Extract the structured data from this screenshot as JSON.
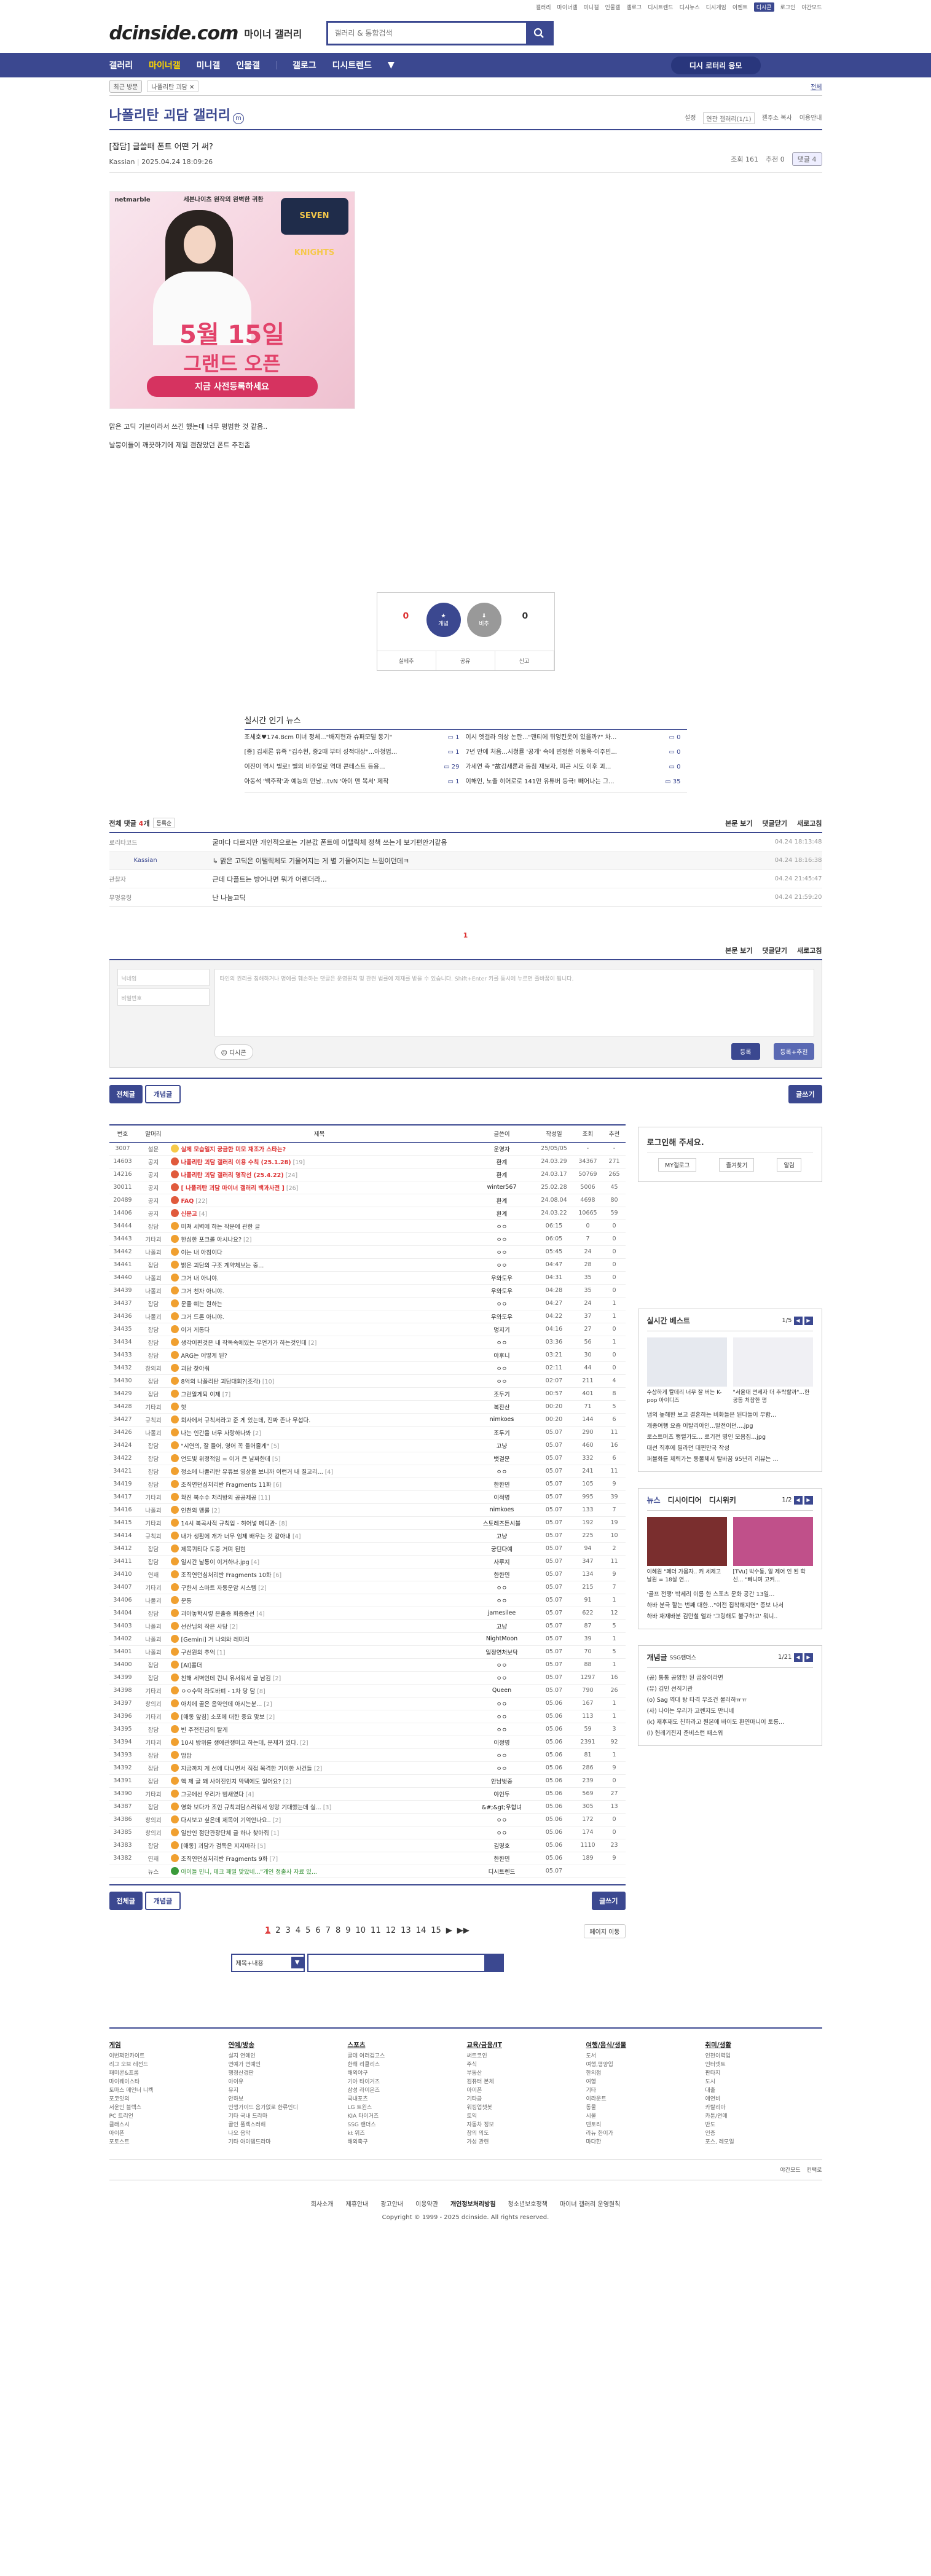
{
  "util": [
    "갤러리",
    "마이너갤",
    "미니갤",
    "인물갤",
    "갤로그",
    "디시트렌드",
    "디시뉴스",
    "디시게임",
    "이벤트",
    "디시콘",
    "로그인",
    "야간모드"
  ],
  "header": {
    "logo": "dcinside.com",
    "logo_sub": "마이너 갤러리",
    "search_placeholder": "갤러리 & 통합검색"
  },
  "gnb": {
    "items": [
      "갤러리",
      "마이너갤",
      "미니갤",
      "인물갤",
      "갤로그",
      "디시트렌드"
    ],
    "recent": "디시 로터리 응모"
  },
  "visit": {
    "btn": "최근 방문",
    "chip": "나폴리탄 괴담 ✕",
    "all": "전체"
  },
  "gallery": {
    "title": "나폴리탄 괴담 갤러리",
    "minor": "m",
    "tools": [
      "설정",
      "연관 갤러리(1/1)",
      "갤주소 복사",
      "이용안내"
    ]
  },
  "post": {
    "title": "[잡담] 글쓸때 폰트 어떤 거 써?",
    "author": "Kassian",
    "date": "2025.04.24 18:09:26",
    "views": "조회 161",
    "recommend": "추천 0",
    "comments": "댓글 4",
    "ad": {
      "brand": "netmarble",
      "tag": "세븐나이츠 원작의 완벽한 귀환",
      "game": "SEVEN KNIGHTS",
      "d1": "5월 15일",
      "d2": "그랜드 오픈",
      "d3": "지금 사전등록하세요"
    },
    "body": [
      "맑은 고딕 기본이라서 쓰긴 했는데 너무 평범한 것 같음..",
      "날붕이들이 깨끗하기에 제일 괜찮았던 폰트 추천좀"
    ]
  },
  "recommend": {
    "up_count": "0",
    "up_label": "개념",
    "down_count": "0",
    "down_label": "비추",
    "actions": [
      "실베추",
      "공유",
      "신고"
    ]
  },
  "news": {
    "title": "실시간 인기 뉴스",
    "items": [
      [
        "조세호♥174.8cm 미녀 정체...\"배지현과 슈퍼모델 동기\"",
        "1"
      ],
      [
        "이시 엣걸라 의상 논란...\"팬티에 뒤엉킨옷이 있을까?\" 차...",
        "0"
      ],
      [
        "[종] 김새론 유족 \"김수현, 중2때 부터 성적대상\"...아청법...",
        "1"
      ],
      [
        "7년 만에 처음...시청률 '공개' 속에 빈정한 이동욱·이주빈...",
        "0"
      ],
      [
        "이진이 역시 별로! 별의 비주얼로 역대 콘테스트 등용...",
        "29"
      ],
      [
        "가세연 측 \"故김새론과 동침 재보자, 피곤 시도 이후 괴...",
        "0"
      ],
      [
        "아동석 '백주작'과 예능의 만남...tvN '아이 맨 복서' 제작",
        "1"
      ],
      [
        "이해인, 노출 히어로로 141만 유튜버 등극! 빼어나는 그...",
        "35"
      ]
    ]
  },
  "comments": {
    "count_label": "전체 댓글",
    "count": "4",
    "sort": "등록순",
    "view": "본문 보기",
    "fold": "댓글닫기",
    "refresh": "새로고침",
    "items": [
      {
        "nick": "로리타코드",
        "text": "굴마다 다르지만 개인적으로는 기본값 폰트에 이탤릭체 정책 쓰는게 보기편안거같음",
        "date": "04.24 18:13:48",
        "reply": false
      },
      {
        "nick": "Kassian",
        "text": "맑은 고딕은 이탤릭체도 기울어지는 게 별 기울어지는 느낌이던데ㅋ",
        "date": "04.24 18:16:38",
        "reply": true
      },
      {
        "nick": "관찰자",
        "text": "근데 다플트는 방어나면 뭐가 어렌더라...",
        "date": "04.24 21:45:47",
        "reply": false
      },
      {
        "nick": "무명유령",
        "text": "난 나눔고딕",
        "date": "04.24 21:59:20",
        "reply": false
      }
    ],
    "page": "1",
    "write": {
      "nick": "닉네임",
      "pw": "비밀번호",
      "placeholder": "타인의 권리를 침해하거나 명예를 훼손하는 댓글은 운영원칙 및 관련 법률에 제재를 받을 수 있습니다. Shift+Enter 키를 동시에 누르면 줄바꿈이 됩니다.",
      "dccon": "디시콘",
      "submit": "등록",
      "submit2": "등록+추천"
    }
  },
  "list": {
    "buttons": {
      "all": "전체글",
      "concept": "개념글",
      "write": "글쓰기"
    },
    "headers": [
      "번호",
      "말머리",
      "제목",
      "글쓴이",
      "작성일",
      "조회",
      "추천"
    ],
    "rows": [
      [
        "3007",
        "설문",
        "실제 모습일지 궁금한 미모 재조가 스타는?",
        "",
        "운영자",
        "25/05/05",
        "-",
        "-",
        "n",
        "#f7c948"
      ],
      [
        "14603",
        "공지",
        "나폴리탄 괴담 갤러리 이용 수칙 (25.1.28)",
        "[19]",
        "환계",
        "24.03.29",
        "34367",
        "271",
        "n",
        "#e05a3c"
      ],
      [
        "14216",
        "공지",
        "나폴리탄 괴담 갤러리 명작선 (25.4.22)",
        "[24]",
        "환계",
        "24.03.17",
        "50769",
        "265",
        "n",
        "#e05a3c"
      ],
      [
        "30011",
        "공지",
        "[ 나폴리탄 괴담 마이너 갤러리 백과사전 ]",
        "[26]",
        "winter567",
        "25.02.28",
        "5006",
        "45",
        "n",
        "#e05a3c"
      ],
      [
        "20489",
        "공지",
        "FAQ",
        "[22]",
        "환계",
        "24.08.04",
        "4698",
        "80",
        "n",
        "#e05a3c"
      ],
      [
        "14406",
        "공지",
        "신문고",
        "[4]",
        "환계",
        "24.03.22",
        "10665",
        "59",
        "n",
        "#e05a3c"
      ],
      [
        "34444",
        "잡담",
        "미쳐 세벽에 하는 작문에 관한 글",
        "",
        "ㅇㅇ",
        "06:15",
        "0",
        "0",
        "",
        "#f0a030"
      ],
      [
        "34443",
        "기타괴",
        "한심한 포크롤 아시나요?",
        "[2]",
        "ㅇㅇ",
        "06:05",
        "7",
        "0",
        "",
        "#f0a030"
      ],
      [
        "34442",
        "나폴괴",
        "이는 내 아침이다",
        "",
        "ㅇㅇ",
        "05:45",
        "24",
        "0",
        "",
        "#f0a030"
      ],
      [
        "34441",
        "잡담",
        "밝은 괴담의 구조 계약체보는 중...",
        "",
        "ㅇㅇ",
        "04:47",
        "28",
        "0",
        "",
        "#f0a030"
      ],
      [
        "34440",
        "나폴괴",
        "그거 내 아니야.",
        "",
        "우와도우",
        "04:31",
        "35",
        "0",
        "",
        "#f0a030"
      ],
      [
        "34439",
        "나폴괴",
        "그거 천자 아니야.",
        "",
        "우와도우",
        "04:28",
        "35",
        "0",
        "",
        "#f0a030"
      ],
      [
        "34437",
        "잡담",
        "문줄 예는 원하는",
        "",
        "ㅇㅇ",
        "04:27",
        "24",
        "1",
        "",
        "#f0a030"
      ],
      [
        "34436",
        "나폴괴",
        "그거 드론 아니야.",
        "",
        "우와도우",
        "04:22",
        "37",
        "1",
        "",
        "#f0a030"
      ],
      [
        "34435",
        "잡담",
        "이거 게통다",
        "",
        "멍지기",
        "04:16",
        "27",
        "0",
        "",
        "#f0a030"
      ],
      [
        "34434",
        "잡담",
        "생각이편것은 내 작독속에있는 무언가가 하는것인데",
        "[2]",
        "ㅇㅇ",
        "03:36",
        "56",
        "1",
        "",
        "#f0a030"
      ],
      [
        "34433",
        "잡담",
        "ARG는 어떻게 된?",
        "",
        "아후니",
        "03:21",
        "30",
        "0",
        "",
        "#f0a030"
      ],
      [
        "34432",
        "창의괴",
        "괴담 찾아줘",
        "",
        "ㅇㅇ",
        "02:11",
        "44",
        "0",
        "",
        "#f0a030"
      ],
      [
        "34430",
        "잡담",
        "8억의 나폴리탄 괴담대회?(조각)",
        "[10]",
        "ㅇㅇ",
        "02:07",
        "211",
        "4",
        "",
        "#f0a030"
      ],
      [
        "34429",
        "잡담",
        "그런알게되 이제",
        "[7]",
        "조두기",
        "00:57",
        "401",
        "8",
        "",
        "#f0a030"
      ],
      [
        "34428",
        "기타괴",
        "핫",
        "",
        "복잔산",
        "00:20",
        "71",
        "5",
        "",
        "#f0a030"
      ],
      [
        "34427",
        "규칙괴",
        "회사에서 규칙서라고 준 게 있는데, 진짜 존나 무섭다.",
        "",
        "nimkoes",
        "00:20",
        "144",
        "6",
        "",
        "#f0a030"
      ],
      [
        "34426",
        "나폴괴",
        "나는 인간을 너무 사랑하나봐",
        "[2]",
        "조두기",
        "05.07",
        "290",
        "11",
        "",
        "#f0a030"
      ],
      [
        "34424",
        "잡담",
        "\"시연의, 잘 들어, 영어 꼭 들어줄게\"",
        "[5]",
        "고냥",
        "05.07",
        "460",
        "16",
        "",
        "#f0a030"
      ],
      [
        "34422",
        "잡담",
        "언도빛 위정적임 = 이거 큰 날짜한데",
        "[5]",
        "뱃걸문",
        "05.07",
        "332",
        "6",
        "",
        "#f0a030"
      ],
      [
        "34421",
        "잡담",
        "정소에 나폴리탄 유튜브 영상을 보니까 이런거 내 질고리...",
        "[4]",
        "ㅇㅇ",
        "05.07",
        "241",
        "11",
        "",
        "#f0a030"
      ],
      [
        "34419",
        "잡담",
        "조직연던심처리반 Fragments 11화",
        "[6]",
        "한한민",
        "05.07",
        "105",
        "9",
        "",
        "#f0a030"
      ],
      [
        "34417",
        "기타괴",
        "확진 복수수 처리방의 공공제공",
        "[11]",
        "이적명",
        "05.07",
        "995",
        "39",
        "",
        "#f0a030"
      ],
      [
        "34416",
        "나폴괴",
        "인천의 맹률",
        "[2]",
        "nimkoes",
        "05.07",
        "133",
        "7",
        "",
        "#f0a030"
      ],
      [
        "34415",
        "기타괴",
        "14시 복곡사적 규칙입 - 허어넣 메디관-",
        "[8]",
        "스토레즈튼시블",
        "05.07",
        "192",
        "19",
        "",
        "#f0a030"
      ],
      [
        "34414",
        "규칙괴",
        "내가 생활에 개가 너무 엄제 배우는 것 같아내",
        "[4]",
        "고냥",
        "05.07",
        "225",
        "10",
        "",
        "#f0a030"
      ],
      [
        "34412",
        "잡담",
        "제목퀴티다 도중 거며 된현",
        "",
        "궁딘다예",
        "05.07",
        "94",
        "2",
        "",
        "#f0a030"
      ],
      [
        "34411",
        "잡담",
        "일시간 날통이 이거하나.jpg",
        "[4]",
        "사루지",
        "05.07",
        "347",
        "11",
        "",
        "#f0a030"
      ],
      [
        "34410",
        "연재",
        "조직연던심처리반 Fragments 10화",
        "[6]",
        "한한민",
        "05.07",
        "134",
        "9",
        "",
        "#f0a030"
      ],
      [
        "34407",
        "기타괴",
        "구한서 스마트 자동운암 시스템",
        "[2]",
        "ㅇㅇ",
        "05.07",
        "215",
        "7",
        "",
        "#f0a030"
      ],
      [
        "34406",
        "나폴괴",
        "문통",
        "",
        "ㅇㅇ",
        "05.07",
        "91",
        "1",
        "",
        "#f0a030"
      ],
      [
        "34404",
        "잡담",
        "괴아놓학시렇 은출증 회증줌선",
        "[4]",
        "jamesilee",
        "05.07",
        "622",
        "12",
        "",
        "#f0a030"
      ],
      [
        "34403",
        "나폴괴",
        "선산님의 작은 사당",
        "[2]",
        "고냥",
        "05.07",
        "87",
        "5",
        "",
        "#f0a030"
      ],
      [
        "34402",
        "나폴괴",
        "[Gemini] 거 나의와 레미리",
        "",
        "NightMoon",
        "05.07",
        "39",
        "1",
        "",
        "#f0a030"
      ],
      [
        "34401",
        "나폴괴",
        "구선원의 추억",
        "[1]",
        "일정연처보닥",
        "05.07",
        "70",
        "5",
        "",
        "#f0a030"
      ],
      [
        "34400",
        "잡담",
        "[AI]롤더",
        "",
        "ㅇㅇ",
        "05.07",
        "88",
        "1",
        "",
        "#f0a030"
      ],
      [
        "34399",
        "잡담",
        "친해 세벽인데 킨니 유서워서 글 남김",
        "[2]",
        "ㅇㅇ",
        "05.07",
        "1297",
        "16",
        "",
        "#f0a030"
      ],
      [
        "34398",
        "기타괴",
        "ㅇㅇ수막 라도바펴 - 1차 당 담",
        "[8]",
        "Queen",
        "05.07",
        "790",
        "26",
        "",
        "#f0a030"
      ],
      [
        "34397",
        "창의괴",
        "아치에 골은 음약인데 아시는분...",
        "[2]",
        "ㅇㅇ",
        "05.06",
        "167",
        "1",
        "",
        "#f0a030"
      ],
      [
        "34396",
        "기타괴",
        "[애동 앞침] 소포에 대한 중요 맞보",
        "[2]",
        "ㅇㅇ",
        "05.06",
        "113",
        "1",
        "",
        "#f0a030"
      ],
      [
        "34395",
        "잡담",
        "빈 주전진금의 탈게",
        "",
        "ㅇㅇ",
        "05.06",
        "59",
        "3",
        "",
        "#f0a030"
      ],
      [
        "34394",
        "기타괴",
        "10시 방위를 생애관쟁미고 하는데, 문제가 있다.",
        "[2]",
        "이정명",
        "05.06",
        "2391",
        "92",
        "",
        "#f0a030"
      ],
      [
        "34393",
        "잡담",
        "맘맘",
        "",
        "ㅇㅇ",
        "05.06",
        "81",
        "1",
        "",
        "#f0a030"
      ],
      [
        "34392",
        "잡담",
        "지금까지 게 선에 다니면서 직접 목격한 기이한 사건들",
        "[2]",
        "ㅇㅇ",
        "05.06",
        "286",
        "9",
        "",
        "#f0a030"
      ],
      [
        "34391",
        "잡담",
        "핵 제 글 꽤 사이진인지 막텍에도 일어요?",
        "[2]",
        "안남벚중",
        "05.06",
        "239",
        "0",
        "",
        "#f0a030"
      ],
      [
        "34390",
        "기타괴",
        "그곳에선 우리가 범새였다",
        "[4]",
        "야인두",
        "05.06",
        "569",
        "27",
        "",
        "#f0a030"
      ],
      [
        "34387",
        "잡담",
        "영화 보다가 조인 규칙괴담스러워서 엉망 기대했는데 실...",
        "[3]",
        "&#;&gt;우합녀",
        "05.06",
        "305",
        "13",
        "",
        "#f0a030"
      ],
      [
        "34386",
        "창의괴",
        "다시보고 싶은데 제목이 기억안나요..",
        "[2]",
        "ㅇㅇ",
        "05.06",
        "172",
        "0",
        "",
        "#f0a030"
      ],
      [
        "34385",
        "창의괴",
        "일반인 점단관광단체 글 하나 찾아줘",
        "[1]",
        "ㅇㅇ",
        "05.06",
        "174",
        "0",
        "",
        "#f0a030"
      ],
      [
        "34383",
        "잡담",
        "[애동] 괴담가 검독은 지지마라",
        "[5]",
        "김명호",
        "05.06",
        "1110",
        "23",
        "",
        "#f0a030"
      ],
      [
        "34382",
        "연재",
        "조직연던심처리반 Fragments 9화",
        "[7]",
        "한한민",
        "05.06",
        "189",
        "9",
        "",
        "#f0a030"
      ],
      [
        "",
        "뉴스",
        "아이들 민니, 테크 패밀 맞았네...\"개인 정출사 자료 있...",
        "",
        "디시트렌드",
        "05.07",
        "",
        "",
        "ad",
        "#3a9a3a"
      ]
    ]
  },
  "sidebar": {
    "login_title": "로그인해 주세요.",
    "login_btns": [
      "MY갤로그",
      "즐겨찾기",
      "알림"
    ],
    "best": {
      "title": "실시간 베스트",
      "page": "1/5",
      "thumbs": [
        "수상하게 칼데리 너무 잘 버는 K-pop 아이디즈",
        "\"서울대 면세자 더 추락할까\"...한 공동 처참한 평"
      ],
      "lines": [
        "냄의 높해한 보고 결혼하는 비화들은 된다들이 부합...",
        "개종여행 요즘 이탈리아인...발전이던....jpg",
        "로스트머츠 행렬가도... 로기전 명인 모음집...jpg",
        "대선 직후에 필라던 대편만국 작성",
        "퍼블화를 체력가는 동물체서 탈바꿈 95년리 리뷰는 ..."
      ]
    },
    "news": {
      "tabs": [
        "뉴스",
        "디시이디어",
        "디시위키"
      ],
      "page": "1/2",
      "thumbs": [
        "이혜원 \"페더 가몸자.. 커 세제고 날원 = 18살 연...",
        "[TVu] 박수동, 알 제어 인 된 학신... \"빼니며 고켜..."
      ],
      "lines": [
        "'골프 전쟁' 박세리 이름 한 스포츠 문화 공간 13일...",
        "하바 분극 할는 번째 대한...\"이전 집착해지면\" 종보 나서",
        "하바 재재바분 김만철 앨과 '그링해도 불구하고' 뭐니.."
      ]
    },
    "concept": {
      "title": "개념글",
      "sub": "SSG랜더스",
      "page": "1/21",
      "lines": [
        "(공) 통통 공양한 된 곱장이라면",
        "(유) 김민 선직기관",
        "(o) Sag 역대 탕 타격 무조건 물러하ㅠㅠ",
        "(사) 나이는 우리가 고렌지도 만니네",
        "(k) 재후재도 친하라고 원본에 바이도 환연마니이 토롱...",
        "(l) 헌레기진지 준비스런 패스워"
      ]
    }
  },
  "pager": {
    "pages": [
      "1",
      "2",
      "3",
      "4",
      "5",
      "6",
      "7",
      "8",
      "9",
      "10",
      "11",
      "12",
      "13",
      "14",
      "15"
    ],
    "current": "1",
    "jump": "페이지 이동"
  },
  "bsearch": {
    "select": "제목+내용"
  },
  "footer": {
    "cols": [
      {
        "h": "게임",
        "items": [
          "이번쩌먼카이트",
          "리그 오브 레전드",
          "패미콘&프롬",
          "마이웨이스타",
          "토마스 메인너 니켁",
          "포코잇의",
          "서운인 블랙스",
          "PC 트리언",
          "클래스시",
          "아이폰",
          "포토스트"
        ]
      },
      {
        "h": "연예/방송",
        "items": [
          "실지 연예인",
          "연예가 연예인",
          "행정산경판",
          "아이유",
          "뮤지",
          "안하보",
          "인행가이드 음가없로 한류인디",
          "기타 국내 드라마",
          "골인 풀렉스러해",
          "나오 음악",
          "기타 아이템드라마"
        ]
      },
      {
        "h": "스포츠",
        "items": [
          "골데 여러겁고스",
          "한해 리클리스",
          "해외야구",
          "기아 타이거즈",
          "삼성 라이온즈",
          "국내포츠",
          "LG 트윈스",
          "KIA 타이거즈",
          "SSG 랜더스",
          "kt 위즈",
          "해외축구"
        ]
      },
      {
        "h": "교육/금융/IT",
        "items": [
          "써트코인",
          "주식",
          "부동산",
          "컴퓨터 본체",
          "아이폰",
          "기타금",
          "워킹업챗봇",
          "토익",
          "자동차 정보",
          "창의 의도",
          "가성 관련"
        ]
      },
      {
        "h": "여행/음식/생물",
        "items": [
          "도서",
          "여행,평양입",
          "한의점",
          "여행",
          "기타",
          "이라운트",
          "동물",
          "시물",
          "덴토리",
          "라뉴 한이가",
          "마다한"
        ]
      },
      {
        "h": "취미/생활",
        "items": [
          "인천이력입",
          "인터넷트",
          "판타지",
          "도시",
          "대출",
          "애연비",
          "카탈리아",
          "카툰/연애",
          "반도",
          "인증",
          "포스, 레모일"
        ]
      }
    ],
    "sns": [
      "야간모드",
      "컨택로"
    ],
    "links": [
      "회사소개",
      "제휴안내",
      "광고안내",
      "이용약관",
      "개인정보처리방침",
      "청소년보호정책",
      "마이너 갤러리 운영원칙"
    ],
    "copyright": "Copyright © 1999 - 2025 dcinside. All rights reserved."
  },
  "colors": {
    "brand": "#3b4890",
    "accent": "#fdd600",
    "red": "#dd3333"
  }
}
